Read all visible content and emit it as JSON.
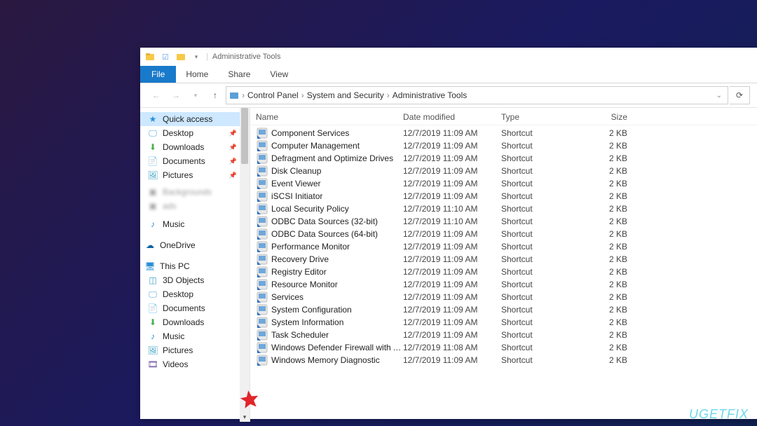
{
  "window": {
    "title": "Administrative Tools"
  },
  "ribbon": {
    "file": "File",
    "tabs": [
      "Home",
      "Share",
      "View"
    ]
  },
  "breadcrumb": [
    "Control Panel",
    "System and Security",
    "Administrative Tools"
  ],
  "columns": {
    "name": "Name",
    "date": "Date modified",
    "type": "Type",
    "size": "Size"
  },
  "sidebar": {
    "quick_access": "Quick access",
    "quick_items": [
      {
        "label": "Desktop",
        "icon": "desktop"
      },
      {
        "label": "Downloads",
        "icon": "downloads"
      },
      {
        "label": "Documents",
        "icon": "documents"
      },
      {
        "label": "Pictures",
        "icon": "pictures"
      }
    ],
    "music_label": "Music",
    "onedrive": "OneDrive",
    "this_pc": "This PC",
    "pc_items": [
      {
        "label": "3D Objects",
        "icon": "3d"
      },
      {
        "label": "Desktop",
        "icon": "desktop"
      },
      {
        "label": "Documents",
        "icon": "documents"
      },
      {
        "label": "Downloads",
        "icon": "downloads"
      },
      {
        "label": "Music",
        "icon": "music"
      },
      {
        "label": "Pictures",
        "icon": "pictures"
      },
      {
        "label": "Videos",
        "icon": "videos"
      }
    ]
  },
  "files": [
    {
      "name": "Component Services",
      "date": "12/7/2019 11:09 AM",
      "type": "Shortcut",
      "size": "2 KB"
    },
    {
      "name": "Computer Management",
      "date": "12/7/2019 11:09 AM",
      "type": "Shortcut",
      "size": "2 KB"
    },
    {
      "name": "Defragment and Optimize Drives",
      "date": "12/7/2019 11:09 AM",
      "type": "Shortcut",
      "size": "2 KB"
    },
    {
      "name": "Disk Cleanup",
      "date": "12/7/2019 11:09 AM",
      "type": "Shortcut",
      "size": "2 KB"
    },
    {
      "name": "Event Viewer",
      "date": "12/7/2019 11:09 AM",
      "type": "Shortcut",
      "size": "2 KB"
    },
    {
      "name": "iSCSI Initiator",
      "date": "12/7/2019 11:09 AM",
      "type": "Shortcut",
      "size": "2 KB"
    },
    {
      "name": "Local Security Policy",
      "date": "12/7/2019 11:10 AM",
      "type": "Shortcut",
      "size": "2 KB"
    },
    {
      "name": "ODBC Data Sources (32-bit)",
      "date": "12/7/2019 11:10 AM",
      "type": "Shortcut",
      "size": "2 KB"
    },
    {
      "name": "ODBC Data Sources (64-bit)",
      "date": "12/7/2019 11:09 AM",
      "type": "Shortcut",
      "size": "2 KB"
    },
    {
      "name": "Performance Monitor",
      "date": "12/7/2019 11:09 AM",
      "type": "Shortcut",
      "size": "2 KB"
    },
    {
      "name": "Recovery Drive",
      "date": "12/7/2019 11:09 AM",
      "type": "Shortcut",
      "size": "2 KB"
    },
    {
      "name": "Registry Editor",
      "date": "12/7/2019 11:09 AM",
      "type": "Shortcut",
      "size": "2 KB"
    },
    {
      "name": "Resource Monitor",
      "date": "12/7/2019 11:09 AM",
      "type": "Shortcut",
      "size": "2 KB"
    },
    {
      "name": "Services",
      "date": "12/7/2019 11:09 AM",
      "type": "Shortcut",
      "size": "2 KB"
    },
    {
      "name": "System Configuration",
      "date": "12/7/2019 11:09 AM",
      "type": "Shortcut",
      "size": "2 KB"
    },
    {
      "name": "System Information",
      "date": "12/7/2019 11:09 AM",
      "type": "Shortcut",
      "size": "2 KB"
    },
    {
      "name": "Task Scheduler",
      "date": "12/7/2019 11:09 AM",
      "type": "Shortcut",
      "size": "2 KB"
    },
    {
      "name": "Windows Defender Firewall with Advanc...",
      "date": "12/7/2019 11:08 AM",
      "type": "Shortcut",
      "size": "2 KB"
    },
    {
      "name": "Windows Memory Diagnostic",
      "date": "12/7/2019 11:09 AM",
      "type": "Shortcut",
      "size": "2 KB"
    }
  ],
  "watermark": "UGETFIX"
}
